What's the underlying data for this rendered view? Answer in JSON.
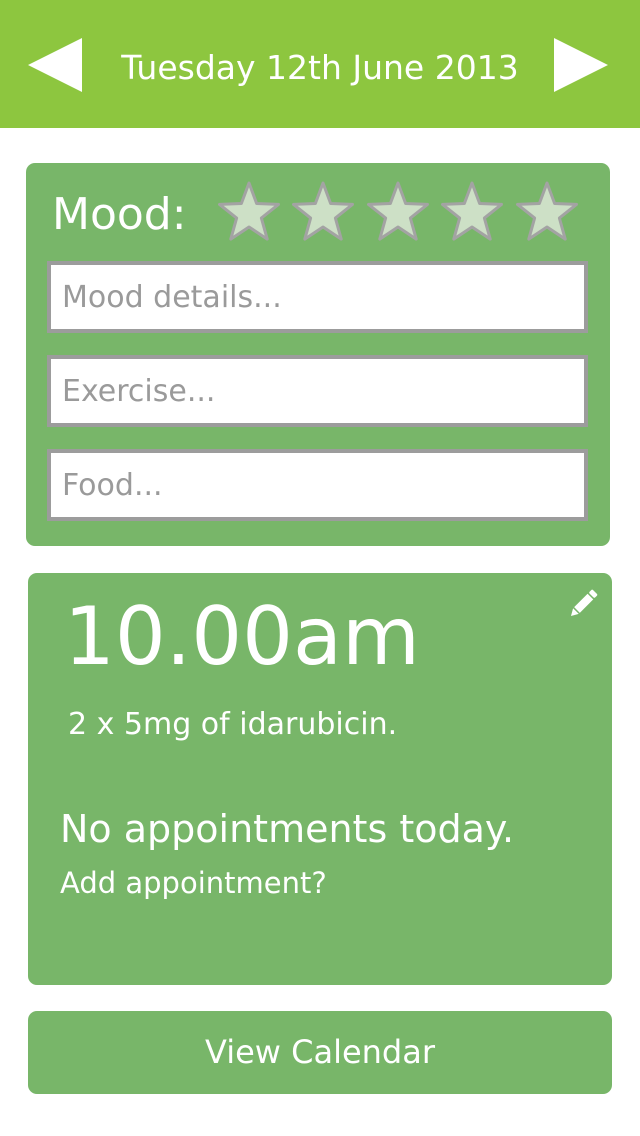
{
  "header": {
    "date": "Tuesday 12th June 2013",
    "prev_icon": "left-triangle-arrow",
    "next_icon": "right-triangle-arrow",
    "background_color": "#8dc63f"
  },
  "mood": {
    "label": "Mood:",
    "rating": 0,
    "max_rating": 5,
    "star_fill_color": "#cde0c6",
    "star_stroke_color": "#a3a3a3",
    "fields": {
      "mood_details_placeholder": "Mood details...",
      "exercise_placeholder": "Exercise...",
      "food_placeholder": "Food..."
    }
  },
  "schedule": {
    "time": "10.00am",
    "medication": "2 x 5mg of idarubicin.",
    "no_appointments": "No appointments today.",
    "add_appointment": "Add appointment?",
    "edit_icon": "pencil-icon"
  },
  "footer": {
    "view_calendar": "View Calendar"
  },
  "colors": {
    "card": "#78b669",
    "accent": "#8dc63f",
    "text_on_green": "#ffffff"
  }
}
